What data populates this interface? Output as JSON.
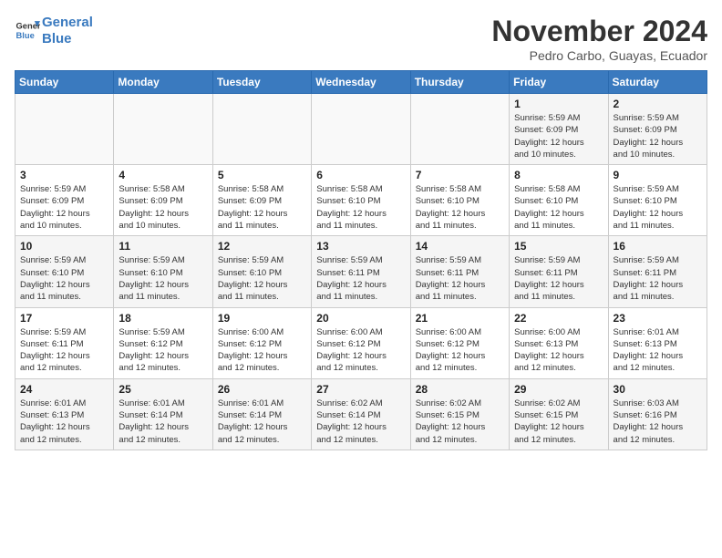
{
  "header": {
    "logo_line1": "General",
    "logo_line2": "Blue",
    "month": "November 2024",
    "location": "Pedro Carbo, Guayas, Ecuador"
  },
  "weekdays": [
    "Sunday",
    "Monday",
    "Tuesday",
    "Wednesday",
    "Thursday",
    "Friday",
    "Saturday"
  ],
  "weeks": [
    [
      {
        "day": "",
        "info": ""
      },
      {
        "day": "",
        "info": ""
      },
      {
        "day": "",
        "info": ""
      },
      {
        "day": "",
        "info": ""
      },
      {
        "day": "",
        "info": ""
      },
      {
        "day": "1",
        "info": "Sunrise: 5:59 AM\nSunset: 6:09 PM\nDaylight: 12 hours\nand 10 minutes."
      },
      {
        "day": "2",
        "info": "Sunrise: 5:59 AM\nSunset: 6:09 PM\nDaylight: 12 hours\nand 10 minutes."
      }
    ],
    [
      {
        "day": "3",
        "info": "Sunrise: 5:59 AM\nSunset: 6:09 PM\nDaylight: 12 hours\nand 10 minutes."
      },
      {
        "day": "4",
        "info": "Sunrise: 5:58 AM\nSunset: 6:09 PM\nDaylight: 12 hours\nand 10 minutes."
      },
      {
        "day": "5",
        "info": "Sunrise: 5:58 AM\nSunset: 6:09 PM\nDaylight: 12 hours\nand 11 minutes."
      },
      {
        "day": "6",
        "info": "Sunrise: 5:58 AM\nSunset: 6:10 PM\nDaylight: 12 hours\nand 11 minutes."
      },
      {
        "day": "7",
        "info": "Sunrise: 5:58 AM\nSunset: 6:10 PM\nDaylight: 12 hours\nand 11 minutes."
      },
      {
        "day": "8",
        "info": "Sunrise: 5:58 AM\nSunset: 6:10 PM\nDaylight: 12 hours\nand 11 minutes."
      },
      {
        "day": "9",
        "info": "Sunrise: 5:59 AM\nSunset: 6:10 PM\nDaylight: 12 hours\nand 11 minutes."
      }
    ],
    [
      {
        "day": "10",
        "info": "Sunrise: 5:59 AM\nSunset: 6:10 PM\nDaylight: 12 hours\nand 11 minutes."
      },
      {
        "day": "11",
        "info": "Sunrise: 5:59 AM\nSunset: 6:10 PM\nDaylight: 12 hours\nand 11 minutes."
      },
      {
        "day": "12",
        "info": "Sunrise: 5:59 AM\nSunset: 6:10 PM\nDaylight: 12 hours\nand 11 minutes."
      },
      {
        "day": "13",
        "info": "Sunrise: 5:59 AM\nSunset: 6:11 PM\nDaylight: 12 hours\nand 11 minutes."
      },
      {
        "day": "14",
        "info": "Sunrise: 5:59 AM\nSunset: 6:11 PM\nDaylight: 12 hours\nand 11 minutes."
      },
      {
        "day": "15",
        "info": "Sunrise: 5:59 AM\nSunset: 6:11 PM\nDaylight: 12 hours\nand 11 minutes."
      },
      {
        "day": "16",
        "info": "Sunrise: 5:59 AM\nSunset: 6:11 PM\nDaylight: 12 hours\nand 11 minutes."
      }
    ],
    [
      {
        "day": "17",
        "info": "Sunrise: 5:59 AM\nSunset: 6:11 PM\nDaylight: 12 hours\nand 12 minutes."
      },
      {
        "day": "18",
        "info": "Sunrise: 5:59 AM\nSunset: 6:12 PM\nDaylight: 12 hours\nand 12 minutes."
      },
      {
        "day": "19",
        "info": "Sunrise: 6:00 AM\nSunset: 6:12 PM\nDaylight: 12 hours\nand 12 minutes."
      },
      {
        "day": "20",
        "info": "Sunrise: 6:00 AM\nSunset: 6:12 PM\nDaylight: 12 hours\nand 12 minutes."
      },
      {
        "day": "21",
        "info": "Sunrise: 6:00 AM\nSunset: 6:12 PM\nDaylight: 12 hours\nand 12 minutes."
      },
      {
        "day": "22",
        "info": "Sunrise: 6:00 AM\nSunset: 6:13 PM\nDaylight: 12 hours\nand 12 minutes."
      },
      {
        "day": "23",
        "info": "Sunrise: 6:01 AM\nSunset: 6:13 PM\nDaylight: 12 hours\nand 12 minutes."
      }
    ],
    [
      {
        "day": "24",
        "info": "Sunrise: 6:01 AM\nSunset: 6:13 PM\nDaylight: 12 hours\nand 12 minutes."
      },
      {
        "day": "25",
        "info": "Sunrise: 6:01 AM\nSunset: 6:14 PM\nDaylight: 12 hours\nand 12 minutes."
      },
      {
        "day": "26",
        "info": "Sunrise: 6:01 AM\nSunset: 6:14 PM\nDaylight: 12 hours\nand 12 minutes."
      },
      {
        "day": "27",
        "info": "Sunrise: 6:02 AM\nSunset: 6:14 PM\nDaylight: 12 hours\nand 12 minutes."
      },
      {
        "day": "28",
        "info": "Sunrise: 6:02 AM\nSunset: 6:15 PM\nDaylight: 12 hours\nand 12 minutes."
      },
      {
        "day": "29",
        "info": "Sunrise: 6:02 AM\nSunset: 6:15 PM\nDaylight: 12 hours\nand 12 minutes."
      },
      {
        "day": "30",
        "info": "Sunrise: 6:03 AM\nSunset: 6:16 PM\nDaylight: 12 hours\nand 12 minutes."
      }
    ]
  ]
}
